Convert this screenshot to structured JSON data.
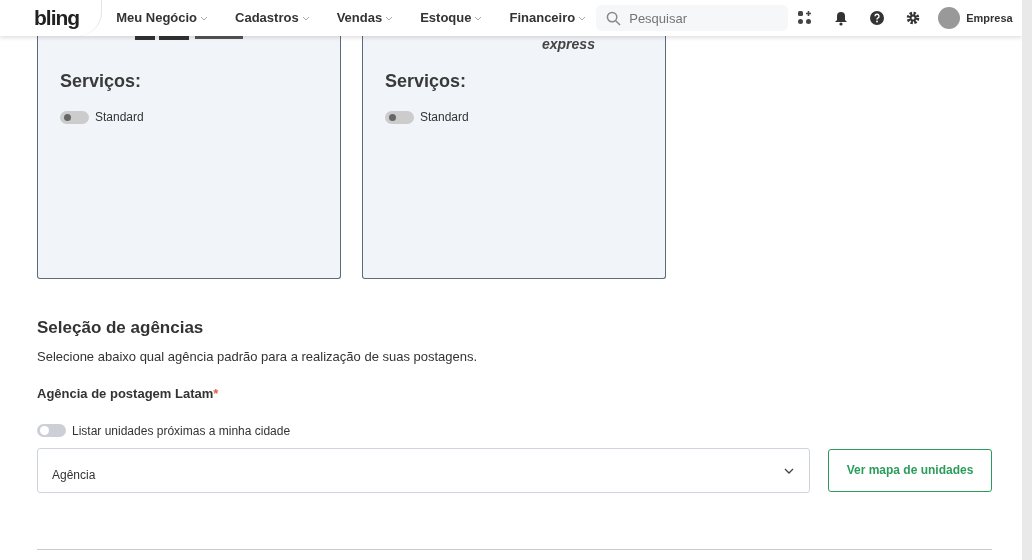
{
  "navbar": {
    "logo": "bling",
    "menu": [
      {
        "label": "Meu Negócio"
      },
      {
        "label": "Cadastros"
      },
      {
        "label": "Vendas"
      },
      {
        "label": "Estoque"
      },
      {
        "label": "Financeiro"
      }
    ],
    "search": {
      "placeholder": "Pesquisar"
    },
    "account": "Empresa"
  },
  "carriers": [
    {
      "services_title": "Serviços:",
      "services": [
        {
          "label": "Standard",
          "on": false
        }
      ]
    },
    {
      "logo_text": "express",
      "services_title": "Serviços:",
      "services": [
        {
          "label": "Standard",
          "on": false
        }
      ]
    }
  ],
  "agency_section": {
    "title": "Seleção de agências",
    "description": "Selecione abaixo qual agência padrão para a realização de suas postagens.",
    "field_label": "Agência de postagem Latam",
    "required_mark": "*",
    "nearby_toggle": {
      "label": "Listar unidades próximas a minha cidade",
      "on": false
    },
    "select": {
      "placeholder": "Agência"
    },
    "map_button": "Ver mapa de unidades"
  }
}
